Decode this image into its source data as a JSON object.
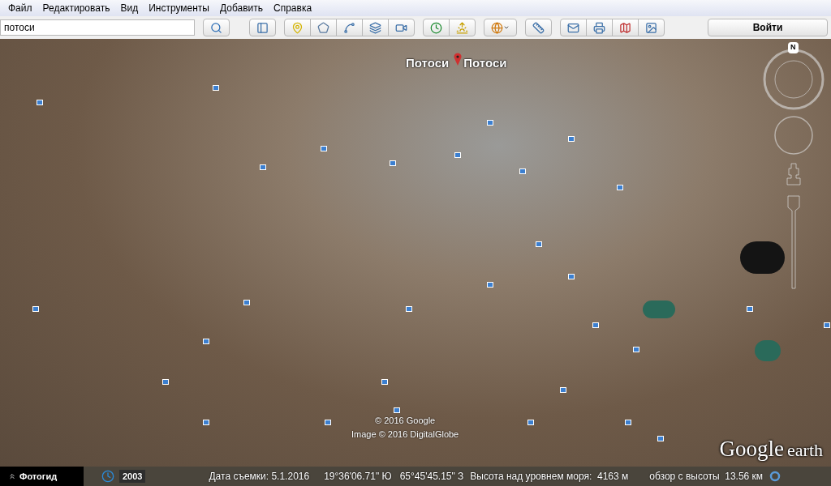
{
  "menu": [
    "Файл",
    "Редактировать",
    "Вид",
    "Инструменты",
    "Добавить",
    "Справка"
  ],
  "search": {
    "value": "потоси"
  },
  "signin_button": "Войти",
  "map": {
    "labels": [
      "Потоси",
      "Потоси"
    ],
    "compass_letter": "N",
    "copyright": [
      "© 2016 Google",
      "Image © 2016 DigitalGlobe"
    ],
    "logo": [
      "Google",
      "earth"
    ]
  },
  "bottom_bar": {
    "photo_guide": "Фотогид",
    "year": "2003",
    "date": "Дата съемки: 5.1.2016",
    "latitude": "19°36'06.71\" Ю",
    "longitude": "65°45'45.15\" З",
    "elevation": "Высота над уровнем моря:  4163 м",
    "eye_altitude": "обзор с высоты  13.56 км"
  }
}
